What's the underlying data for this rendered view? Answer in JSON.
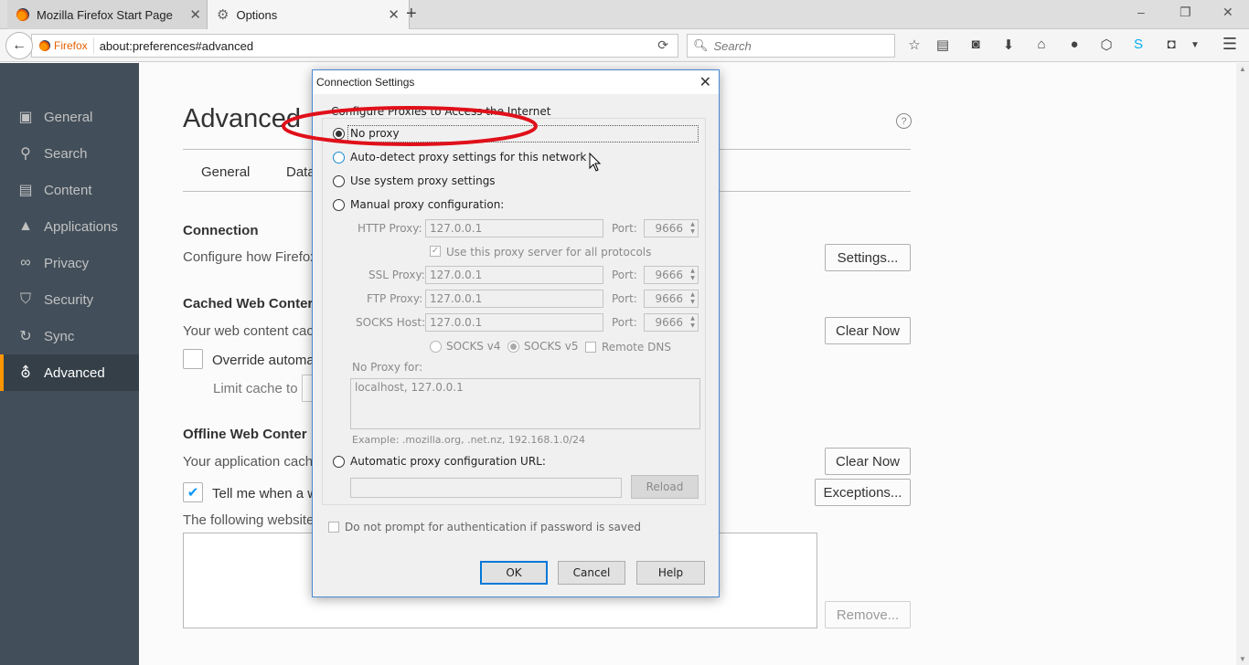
{
  "tabs": [
    {
      "title": "Mozilla Firefox Start Page",
      "icon": "firefox-icon"
    },
    {
      "title": "Options",
      "icon": "gear-icon"
    }
  ],
  "new_tab": "+",
  "window_controls": {
    "minimize": "–",
    "restore": "❐",
    "close": "✕"
  },
  "nav": {
    "identity": "Firefox",
    "url": "about:preferences#advanced",
    "search_placeholder": "Search"
  },
  "toolbar_icons": [
    "star-icon",
    "reading-list-icon",
    "pocket-icon",
    "download-icon",
    "home-icon",
    "chat-icon",
    "extension-icon",
    "skype-icon",
    "screenshot-icon",
    "dropdown-icon",
    "menu-icon"
  ],
  "sidebar": [
    {
      "label": "General",
      "icon": "general-icon"
    },
    {
      "label": "Search",
      "icon": "search-icon"
    },
    {
      "label": "Content",
      "icon": "content-icon"
    },
    {
      "label": "Applications",
      "icon": "applications-icon"
    },
    {
      "label": "Privacy",
      "icon": "privacy-icon"
    },
    {
      "label": "Security",
      "icon": "security-icon"
    },
    {
      "label": "Sync",
      "icon": "sync-icon"
    },
    {
      "label": "Advanced",
      "icon": "advanced-icon"
    }
  ],
  "page": {
    "title": "Advanced",
    "help": "?",
    "subtabs": [
      "General",
      "Data"
    ],
    "connection": {
      "heading": "Connection",
      "desc": "Configure how Firefox",
      "button": "Settings..."
    },
    "cache": {
      "heading": "Cached Web Conter",
      "desc": "Your web content cac",
      "button": "Clear Now",
      "override": "Override automa",
      "limit": "Limit cache to"
    },
    "offline": {
      "heading": "Offline Web Conter",
      "desc": "Your application cach",
      "clear": "Clear Now",
      "exceptions": "Exceptions...",
      "tell": "Tell me when a w",
      "following": "The following website",
      "remove": "Remove..."
    }
  },
  "dialog": {
    "title": "Connection Settings",
    "close": "✕",
    "group": "Configure Proxies to Access the Internet",
    "options": [
      "No proxy",
      "Auto-detect proxy settings for this network",
      "Use system proxy settings",
      "Manual proxy configuration:",
      "Automatic proxy configuration URL:"
    ],
    "selected": "No proxy",
    "http": {
      "label": "HTTP Proxy:",
      "value": "127.0.0.1",
      "port_label": "Port:",
      "port": "9666"
    },
    "use_all": "Use this proxy server for all protocols",
    "ssl": {
      "label": "SSL Proxy:",
      "value": "127.0.0.1",
      "port_label": "Port:",
      "port": "9666"
    },
    "ftp": {
      "label": "FTP Proxy:",
      "value": "127.0.0.1",
      "port_label": "Port:",
      "port": "9666"
    },
    "socks": {
      "label": "SOCKS Host:",
      "value": "127.0.0.1",
      "port_label": "Port:",
      "port": "9666"
    },
    "socks_v4": "SOCKS v4",
    "socks_v5": "SOCKS v5",
    "remote_dns": "Remote DNS",
    "no_proxy_label": "No Proxy for:",
    "no_proxy_value": "localhost, 127.0.0.1",
    "example": "Example: .mozilla.org, .net.nz, 192.168.1.0/24",
    "reload": "Reload",
    "no_prompt": "Do not prompt for authentication if password is saved",
    "ok": "OK",
    "cancel": "Cancel",
    "help": "Help"
  },
  "annotation_color": "#e0101a"
}
